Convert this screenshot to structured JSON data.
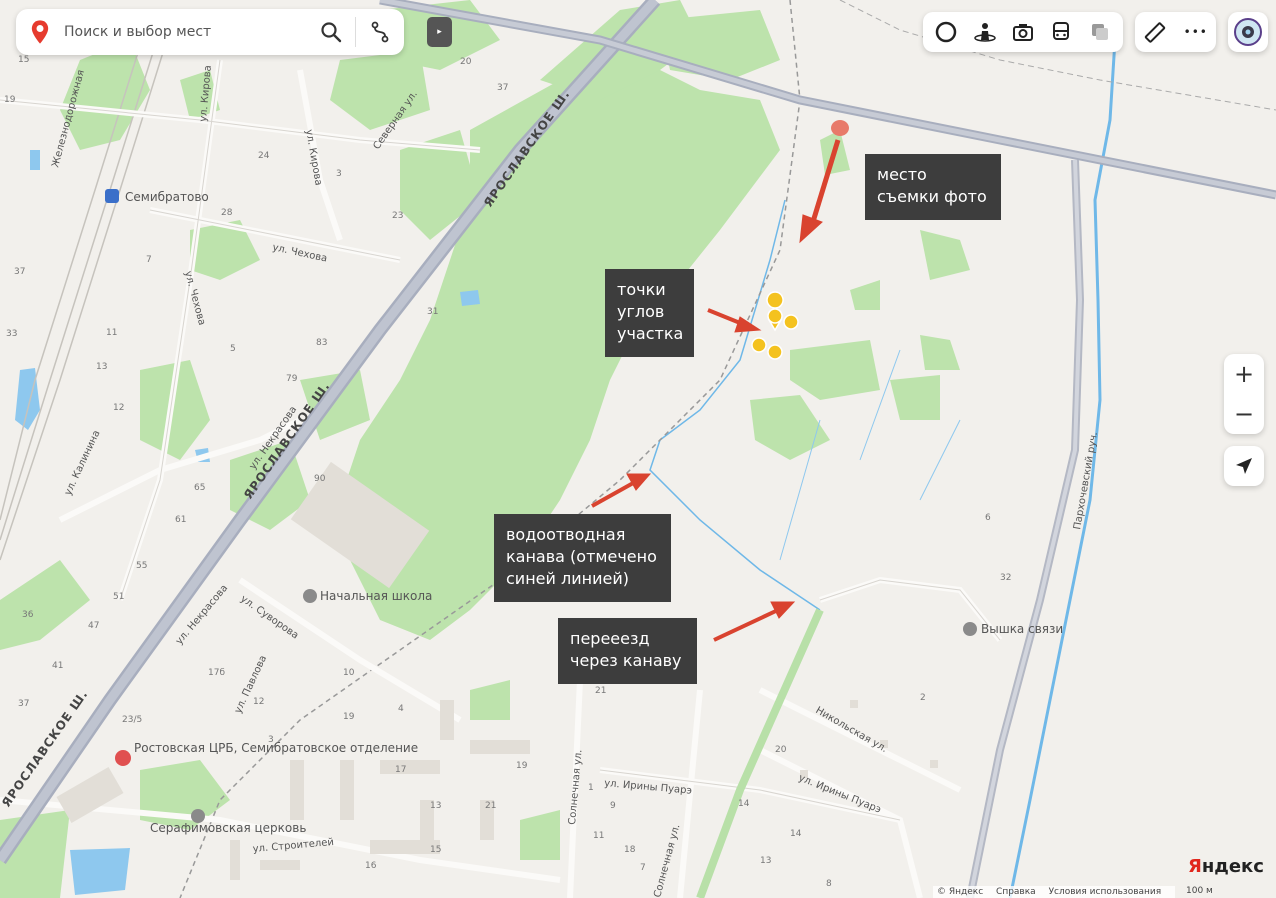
{
  "search": {
    "placeholder": "Поиск и выбор мест"
  },
  "map_labels": {
    "streets": {
      "yaroslavskoe_1": "ЯРОСЛАВСКОЕ Ш.",
      "yaroslavskoe_2": "ЯРОСЛАВСКОЕ Ш.",
      "yaroslavskoe_3": "ЯРОСЛАВСКОЕ Ш.",
      "zheleznodorozhnaya": "Железнодорожная",
      "kirova_1": "ул. Кирова",
      "kirova_2": "ул. Кирова",
      "severnaya": "Северная ул.",
      "chekhova_1": "ул. Чехова",
      "chekhova_2": "ул. Чехова",
      "nekrasova_1": "ул. Некрасова",
      "nekrasova_2": "ул. Некрасова",
      "kalinina": "ул. Калинина",
      "suvorova": "ул. Суворова",
      "pavlova": "ул. Павлова",
      "stroiteley": "ул. Строителей",
      "solnechnaya": "Солнечная ул.",
      "solnechnaya_2": "Солнечная ул.",
      "iriny_1": "ул. Ирины Пуарэ",
      "iriny_2": "ул. Ирины Пуарэ",
      "nikolskaya": "Никольская ул.",
      "parkhovsky": "Пархочевский руч."
    },
    "pois": {
      "station": "Семибратово",
      "school": "Начальная школа",
      "tower": "Вышка связи",
      "hospital": "Ростовская ЦРБ, Семибратовское отделение",
      "church": "Серафимовская церковь"
    },
    "house_numbers": [
      "15",
      "19",
      "20",
      "37",
      "24",
      "3",
      "23",
      "28",
      "7",
      "37",
      "33",
      "11",
      "13",
      "12",
      "31",
      "5",
      "83",
      "79",
      "65",
      "61",
      "90",
      "55",
      "51",
      "47",
      "36",
      "41",
      "37",
      "23/5",
      "17б",
      "4",
      "10",
      "12",
      "19",
      "3",
      "21",
      "17",
      "13",
      "21",
      "19",
      "20",
      "14",
      "13",
      "14",
      "8",
      "2",
      "32",
      "6",
      "15",
      "16",
      "1",
      "9",
      "11",
      "18",
      "7"
    ]
  },
  "annotations": {
    "photo_place": "место\nсъемки фото",
    "corner_points": "точки\nуглов\nучастка",
    "ditch": "водоотводная\nканава (отмечено\nсиней линией)",
    "crossing": "перееезд\nчерез канаву"
  },
  "controls": {
    "zoom_in": "+",
    "zoom_out": "−",
    "collapse": "▸",
    "more": "•••"
  },
  "brand": {
    "first": "Я",
    "rest": "ндекс"
  },
  "footer": {
    "copyright": "© Яндекс",
    "help": "Справка",
    "terms": "Условия использования",
    "scale": "100 м"
  },
  "colors": {
    "background": "#f2f0ec",
    "forest": "#b8e0a8",
    "highway": "#a8aebe",
    "water": "#6fb8e8",
    "arrow": "#d9432f",
    "marker": "#f4c21f",
    "note_bg": "#3d3d3d"
  }
}
